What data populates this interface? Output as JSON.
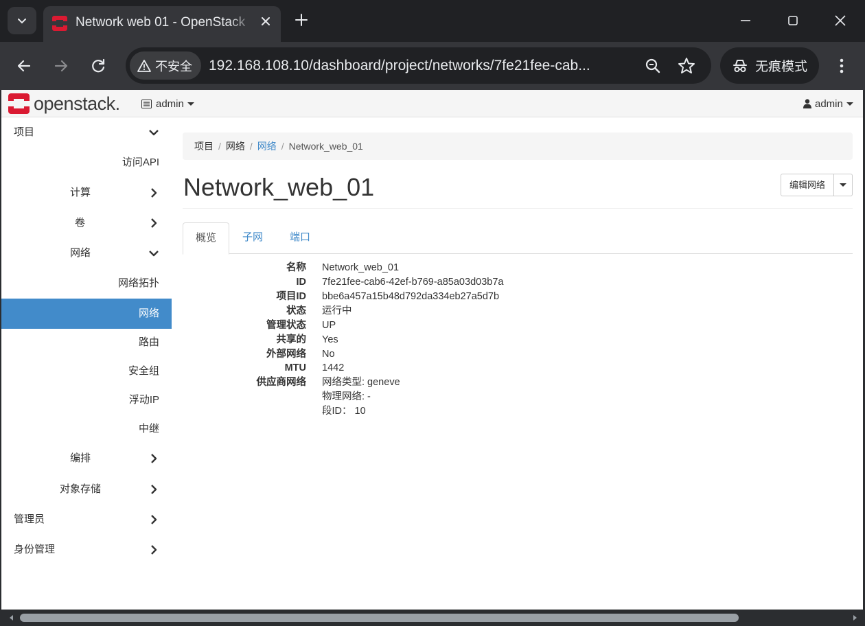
{
  "browser": {
    "tab_title": "Network web 01 - OpenStack",
    "security_label": "不安全",
    "url": "192.168.108.10/dashboard/project/networks/7fe21fee-cab...",
    "incognito_label": "无痕模式",
    "colors": {
      "frame": "#202124",
      "toolbar": "#35363a",
      "text": "#e8eaed"
    }
  },
  "navbar": {
    "logo_text": "openstack.",
    "project": "admin",
    "user": "admin",
    "logo_color": "#da1a32"
  },
  "sidebar": {
    "items": [
      {
        "label": "项目",
        "icon": "chevron-down-icon"
      },
      {
        "label": "访问API"
      },
      {
        "label": "计算",
        "icon": "chevron-right-icon"
      },
      {
        "label": "卷",
        "icon": "chevron-right-icon"
      },
      {
        "label": "网络",
        "icon": "chevron-down-icon"
      },
      {
        "label": "网络拓扑"
      },
      {
        "label": "网络",
        "active": true
      },
      {
        "label": "路由"
      },
      {
        "label": "安全组"
      },
      {
        "label": "浮动IP"
      },
      {
        "label": "中继"
      },
      {
        "label": "编排",
        "icon": "chevron-right-icon"
      },
      {
        "label": "对象存储",
        "icon": "chevron-right-icon"
      },
      {
        "label": "管理员",
        "icon": "chevron-right-icon"
      },
      {
        "label": "身份管理",
        "icon": "chevron-right-icon"
      }
    ],
    "active_color": "#428bca"
  },
  "breadcrumb": {
    "items": [
      "项目",
      "网络",
      "网络",
      "Network_web_01"
    ]
  },
  "page": {
    "title": "Network_web_01",
    "edit_button": "编辑网络"
  },
  "tabs": [
    "概览",
    "子网",
    "端口"
  ],
  "details": [
    {
      "label": "名称",
      "value": "Network_web_01"
    },
    {
      "label": "ID",
      "value": "7fe21fee-cab6-42ef-b769-a85a03d03b7a"
    },
    {
      "label": "项目ID",
      "value": "bbe6a457a15b48d792da334eb27a5d7b"
    },
    {
      "label": "状态",
      "value": "运行中"
    },
    {
      "label": "管理状态",
      "value": "UP"
    },
    {
      "label": "共享的",
      "value": "Yes"
    },
    {
      "label": "外部网络",
      "value": "No"
    },
    {
      "label": "MTU",
      "value": "1442"
    },
    {
      "label": "供应商网络",
      "value": "网络类型: geneve"
    },
    {
      "label": "",
      "value": "物理网络: -"
    },
    {
      "label": "",
      "value": "段ID： 10"
    }
  ]
}
